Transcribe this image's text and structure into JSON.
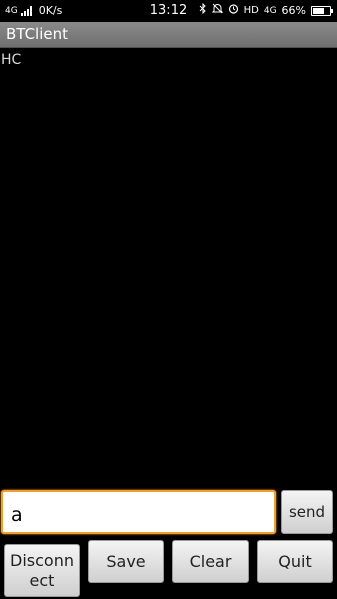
{
  "status_bar": {
    "network_type": "4G",
    "speed": "0K/s",
    "time": "13:12",
    "hd_label": "HD",
    "network_type_right": "4G",
    "battery_percent": "66%",
    "battery_level": 0.66
  },
  "app": {
    "title": "BTClient"
  },
  "output": {
    "lines": [
      "HC"
    ]
  },
  "input": {
    "value": "a"
  },
  "buttons": {
    "send": "send",
    "disconnect": "Disconnect",
    "save": "Save",
    "clear": "Clear",
    "quit": "Quit"
  },
  "colors": {
    "input_focus_border": "#f0a030",
    "titlebar": "#7d7d7d"
  }
}
